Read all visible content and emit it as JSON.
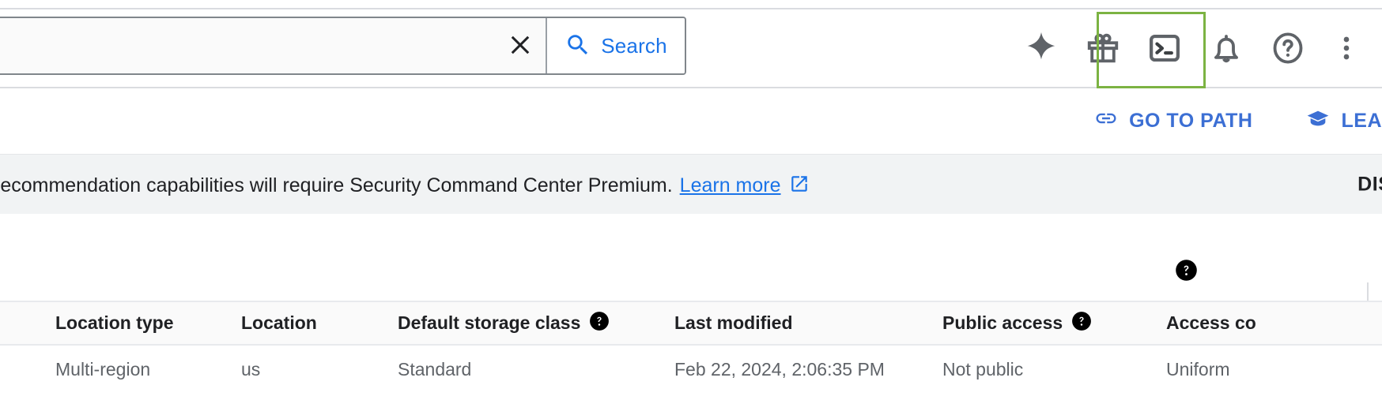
{
  "search": {
    "value": "",
    "placeholder": "",
    "clear_icon": "close-icon",
    "search_icon": "search-icon",
    "button_label": "Search"
  },
  "header_icons": [
    {
      "name": "gemini-sparkle-icon",
      "label": "Gemini"
    },
    {
      "name": "gift-icon",
      "label": "Offers"
    },
    {
      "name": "cloud-shell-terminal-icon",
      "label": "Activate Cloud Shell"
    },
    {
      "name": "notifications-bell-icon",
      "label": "Notifications"
    },
    {
      "name": "help-circle-icon",
      "label": "Help"
    },
    {
      "name": "kebab-more-icon",
      "label": "More options"
    }
  ],
  "highlight": {
    "target": "cloud-shell-terminal-icon",
    "color": "#7cb342"
  },
  "actions": [
    {
      "icon": "link-chain-icon",
      "label": "GO TO PATH"
    },
    {
      "icon": "graduation-cap-icon",
      "label": "LEA"
    }
  ],
  "banner": {
    "text": "recommendation capabilities will require Security Command Center Premium.",
    "link_label": "Learn more",
    "link_icon": "external-link-icon",
    "dismiss_label": "DISM"
  },
  "table": {
    "help_badge_icon": "help-filled-icon",
    "columns": [
      {
        "label": "",
        "help": false
      },
      {
        "label": "Location type",
        "help": false
      },
      {
        "label": "Location",
        "help": false
      },
      {
        "label": "Default storage class",
        "help": true
      },
      {
        "label": "Last modified",
        "help": false
      },
      {
        "label": "Public access",
        "help": true
      },
      {
        "label": "Access co",
        "help": false
      }
    ],
    "rows": [
      {
        "cells": [
          "",
          "Multi-region",
          "us",
          "Standard",
          "Feb 22, 2024, 2:06:35 PM",
          "Not public",
          "Uniform"
        ]
      }
    ]
  },
  "colors": {
    "accent_blue": "#1a73e8",
    "action_blue": "#3c6fd4",
    "highlight_green": "#7cb342",
    "banner_bg": "#f1f3f4",
    "icon_gray": "#5f6368"
  }
}
